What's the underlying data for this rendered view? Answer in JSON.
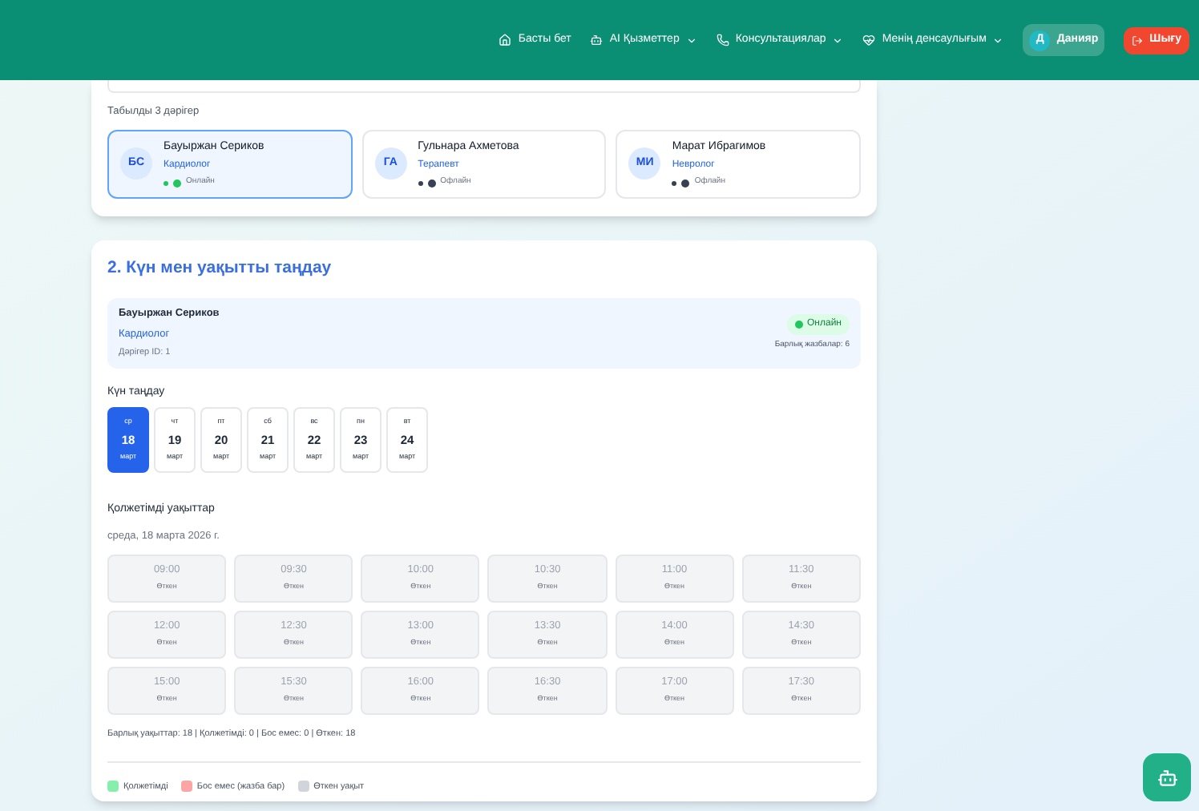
{
  "nav": {
    "items": [
      {
        "label": "Басты бет",
        "caret": false
      },
      {
        "label": "AI Қызметтер",
        "caret": true
      },
      {
        "label": "Консультациялар",
        "caret": true
      },
      {
        "label": "Менің денсаулығым",
        "caret": true
      }
    ],
    "user": {
      "initial": "Д",
      "name": "Данияр"
    },
    "logout": "Шығу"
  },
  "found_label": "Табылды 3 дәрігер",
  "doctors": [
    {
      "initials": "БС",
      "name": "Бауыржан Сериков",
      "specialty": "Кардиолог",
      "status": "Онлайн",
      "color": "#22c55e",
      "selected": true
    },
    {
      "initials": "ГА",
      "name": "Гульнара Ахметова",
      "specialty": "Терапевт",
      "status": "Офлайн",
      "color": "#374151",
      "selected": false
    },
    {
      "initials": "МИ",
      "name": "Марат Ибрагимов",
      "specialty": "Невролог",
      "status": "Офлайн",
      "color": "#374151",
      "selected": false
    }
  ],
  "step2": {
    "title": "2. Күн мен уақытты таңдау",
    "doctor": {
      "name": "Бауыржан Сериков",
      "specialty": "Кардиолог",
      "id": "Дәрігер ID: 1",
      "status": "Онлайн",
      "appointments": "Барлық жазбалар: 6"
    },
    "date_label": "Күн таңдау",
    "days": [
      {
        "weekday": "ср",
        "day": "18",
        "month": "март",
        "selected": true
      },
      {
        "weekday": "чт",
        "day": "19",
        "month": "март",
        "selected": false
      },
      {
        "weekday": "пт",
        "day": "20",
        "month": "март",
        "selected": false
      },
      {
        "weekday": "сб",
        "day": "21",
        "month": "март",
        "selected": false
      },
      {
        "weekday": "вс",
        "day": "22",
        "month": "март",
        "selected": false
      },
      {
        "weekday": "пн",
        "day": "23",
        "month": "март",
        "selected": false
      },
      {
        "weekday": "вт",
        "day": "24",
        "month": "март",
        "selected": false
      }
    ],
    "times_label": "Қолжетімді уақыттар",
    "date_text": "среда, 18 марта 2026 г.",
    "slots": [
      {
        "time": "09:00",
        "status": "Өткен",
        "kind": "past"
      },
      {
        "time": "09:30",
        "status": "Өткен",
        "kind": "past"
      },
      {
        "time": "10:00",
        "status": "Өткен",
        "kind": "past"
      },
      {
        "time": "10:30",
        "status": "Өткен",
        "kind": "past"
      },
      {
        "time": "11:00",
        "status": "Өткен",
        "kind": "past"
      },
      {
        "time": "11:30",
        "status": "Өткен",
        "kind": "past"
      },
      {
        "time": "12:00",
        "status": "Өткен",
        "kind": "past"
      },
      {
        "time": "12:30",
        "status": "Өткен",
        "kind": "past"
      },
      {
        "time": "13:00",
        "status": "Өткен",
        "kind": "past"
      },
      {
        "time": "13:30",
        "status": "Өткен",
        "kind": "past"
      },
      {
        "time": "14:00",
        "status": "Өткен",
        "kind": "past"
      },
      {
        "time": "14:30",
        "status": "Өткен",
        "kind": "past"
      },
      {
        "time": "15:00",
        "status": "Өткен",
        "kind": "past"
      },
      {
        "time": "15:30",
        "status": "Өткен",
        "kind": "past"
      },
      {
        "time": "16:00",
        "status": "Өткен",
        "kind": "past"
      },
      {
        "time": "16:30",
        "status": "Өткен",
        "kind": "past"
      },
      {
        "time": "17:00",
        "status": "Өткен",
        "kind": "past"
      },
      {
        "time": "17:30",
        "status": "Өткен",
        "kind": "past"
      }
    ],
    "summary": "Барлық уақыттар: 18 | Қолжетімді: 0 | Бос емес: 0 | Өткен: 18",
    "legend": [
      {
        "label": "Қолжетімді",
        "color": "#86efac"
      },
      {
        "label": "Бос емес (жазба бар)",
        "color": "#fca5a5"
      },
      {
        "label": "Өткен уақыт",
        "color": "#d1d5db"
      }
    ]
  }
}
